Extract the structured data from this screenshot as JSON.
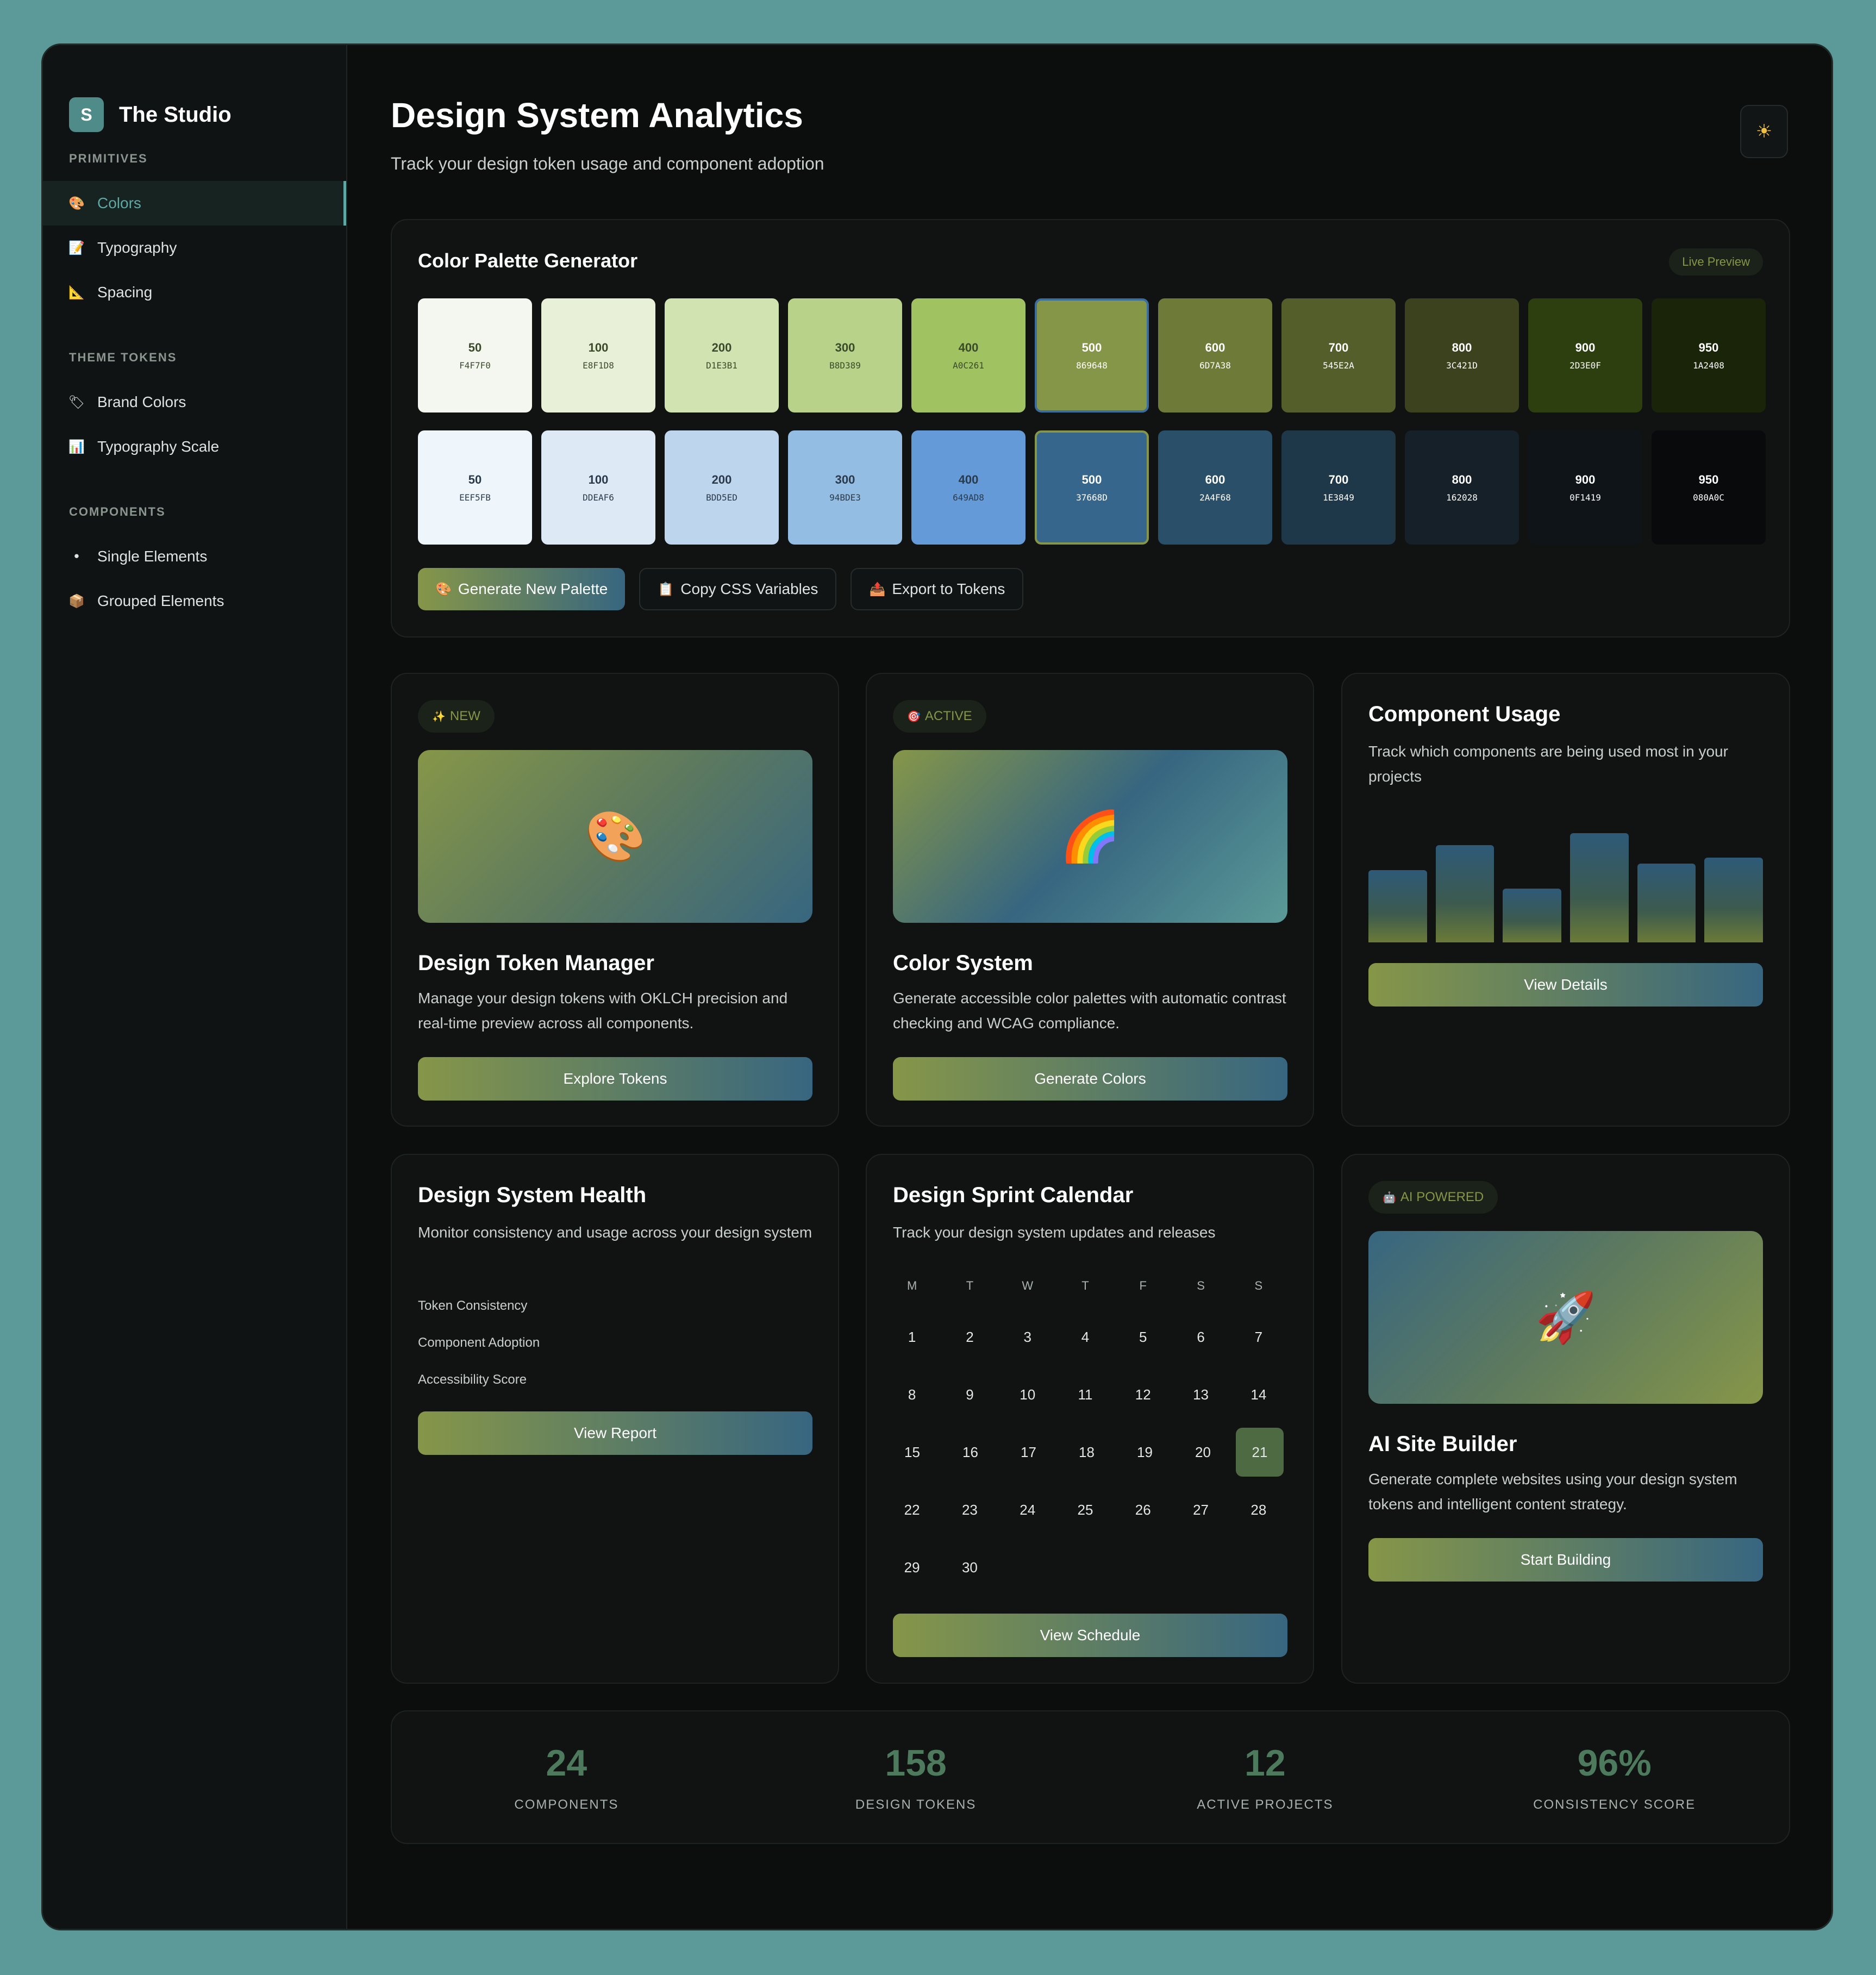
{
  "sidebar": {
    "brand_initial": "S",
    "brand_name": "The Studio",
    "sections": [
      {
        "label": "PRIMITIVES",
        "items": [
          {
            "label": "Colors",
            "icon": "🎨"
          },
          {
            "label": "Typography",
            "icon": "📝"
          },
          {
            "label": "Spacing",
            "icon": "📐"
          }
        ]
      },
      {
        "label": "THEME TOKENS",
        "items": [
          {
            "label": "Brand Colors",
            "icon": "🏷"
          },
          {
            "label": "Typography Scale",
            "icon": "📊"
          }
        ]
      },
      {
        "label": "COMPONENTS",
        "items": [
          {
            "label": "Single Elements",
            "icon": "⚫"
          },
          {
            "label": "Grouped Elements",
            "icon": "📦"
          }
        ]
      }
    ]
  },
  "header": {
    "title": "Design System Analytics",
    "subtitle": "Track your design token usage and component adoption",
    "theme_icon": "☀"
  },
  "palette": {
    "title": "Color Palette Generator",
    "badge": "Live Preview",
    "primary": [
      {
        "shade": "50",
        "hex": "F4F7F0",
        "color": "#F4F7F0",
        "text": "#3a4a2a"
      },
      {
        "shade": "100",
        "hex": "E8F1D8",
        "color": "#E8F1D8",
        "text": "#3a4a2a"
      },
      {
        "shade": "200",
        "hex": "D1E3B1",
        "color": "#D1E3B1",
        "text": "#3a4a2a"
      },
      {
        "shade": "300",
        "hex": "B8D389",
        "color": "#B8D389",
        "text": "#3a4a2a"
      },
      {
        "shade": "400",
        "hex": "A0C261",
        "color": "#A0C261",
        "text": "#3a4a2a"
      },
      {
        "shade": "500",
        "hex": "869648",
        "color": "#869648",
        "text": "#ffffff"
      },
      {
        "shade": "600",
        "hex": "6D7A38",
        "color": "#6D7A38",
        "text": "#ffffff"
      },
      {
        "shade": "700",
        "hex": "545E2A",
        "color": "#545E2A",
        "text": "#ffffff"
      },
      {
        "shade": "800",
        "hex": "3C421D",
        "color": "#3C421D",
        "text": "#ffffff"
      },
      {
        "shade": "900",
        "hex": "2D3E0F",
        "color": "#2D3E0F",
        "text": "#ffffff"
      },
      {
        "shade": "950",
        "hex": "1A2408",
        "color": "#1A2408",
        "text": "#ffffff"
      }
    ],
    "secondary": [
      {
        "shade": "50",
        "hex": "EEF5FB",
        "color": "#EEF5FB",
        "text": "#2a3a4a"
      },
      {
        "shade": "100",
        "hex": "DDEAF6",
        "color": "#DDEAF6",
        "text": "#2a3a4a"
      },
      {
        "shade": "200",
        "hex": "BDD5ED",
        "color": "#BDD5ED",
        "text": "#2a3a4a"
      },
      {
        "shade": "300",
        "hex": "94BDE3",
        "color": "#94BDE3",
        "text": "#2a3a4a"
      },
      {
        "shade": "400",
        "hex": "649AD8",
        "color": "#649AD8",
        "text": "#2a3a4a"
      },
      {
        "shade": "500",
        "hex": "37668D",
        "color": "#37668D",
        "text": "#ffffff"
      },
      {
        "shade": "600",
        "hex": "2A4F68",
        "color": "#2A4F68",
        "text": "#ffffff"
      },
      {
        "shade": "700",
        "hex": "1E3849",
        "color": "#1E3849",
        "text": "#ffffff"
      },
      {
        "shade": "800",
        "hex": "162028",
        "color": "#162028",
        "text": "#ffffff"
      },
      {
        "shade": "900",
        "hex": "0F1419",
        "color": "#0F1419",
        "text": "#ffffff"
      },
      {
        "shade": "950",
        "hex": "080A0C",
        "color": "#080A0C",
        "text": "#ffffff"
      }
    ],
    "actions": [
      {
        "label": "Generate New Palette",
        "icon": "🎨"
      },
      {
        "label": "Copy CSS Variables",
        "icon": "📋"
      },
      {
        "label": "Export to Tokens",
        "icon": "📤"
      }
    ]
  },
  "cards": {
    "token_manager": {
      "badge": "NEW",
      "badge_icon": "✨",
      "emoji": "🎨",
      "title": "Design Token Manager",
      "desc": "Manage your design tokens with OKLCH precision and real-time preview across all components.",
      "button": "Explore Tokens"
    },
    "color_system": {
      "badge": "ACTIVE",
      "badge_icon": "🎯",
      "emoji": "🌈",
      "title": "Color System",
      "desc": "Generate accessible color palettes with automatic contrast checking and WCAG compliance.",
      "button": "Generate Colors"
    },
    "component_usage": {
      "title": "Component Usage",
      "desc": "Track which components are being used most in your projects",
      "bars": [
        0.59,
        0.79,
        0.44,
        0.89,
        0.64,
        0.69
      ],
      "button": "View Details"
    },
    "health": {
      "title": "Design System Health",
      "desc": "Monitor consistency and usage across your design system",
      "metrics": [
        "Token Consistency",
        "Component Adoption",
        "Accessibility Score"
      ],
      "button": "View Report"
    },
    "calendar": {
      "title": "Design Sprint Calendar",
      "desc": "Track your design system updates and releases",
      "weekdays": [
        "M",
        "T",
        "W",
        "T",
        "F",
        "S",
        "S"
      ],
      "weeks": [
        [
          "1",
          "2",
          "3",
          "4",
          "5",
          "6",
          "7"
        ],
        [
          "8",
          "9",
          "10",
          "11",
          "12",
          "13",
          "14"
        ],
        [
          "15",
          "16",
          "17",
          "18",
          "19",
          "20",
          "21"
        ],
        [
          "22",
          "23",
          "24",
          "25",
          "26",
          "27",
          "28"
        ],
        [
          "29",
          "30",
          "",
          "",
          "",
          "",
          ""
        ]
      ],
      "today": "21",
      "button": "View Schedule"
    },
    "ai_builder": {
      "badge": "AI POWERED",
      "badge_icon": "🤖",
      "emoji": "🚀",
      "title": "AI Site Builder",
      "desc": "Generate complete websites using your design system tokens and intelligent content strategy.",
      "button": "Start Building"
    }
  },
  "stats": [
    {
      "value": "24",
      "label": "COMPONENTS"
    },
    {
      "value": "158",
      "label": "DESIGN TOKENS"
    },
    {
      "value": "12",
      "label": "ACTIVE PROJECTS"
    },
    {
      "value": "96%",
      "label": "CONSISTENCY SCORE"
    }
  ]
}
